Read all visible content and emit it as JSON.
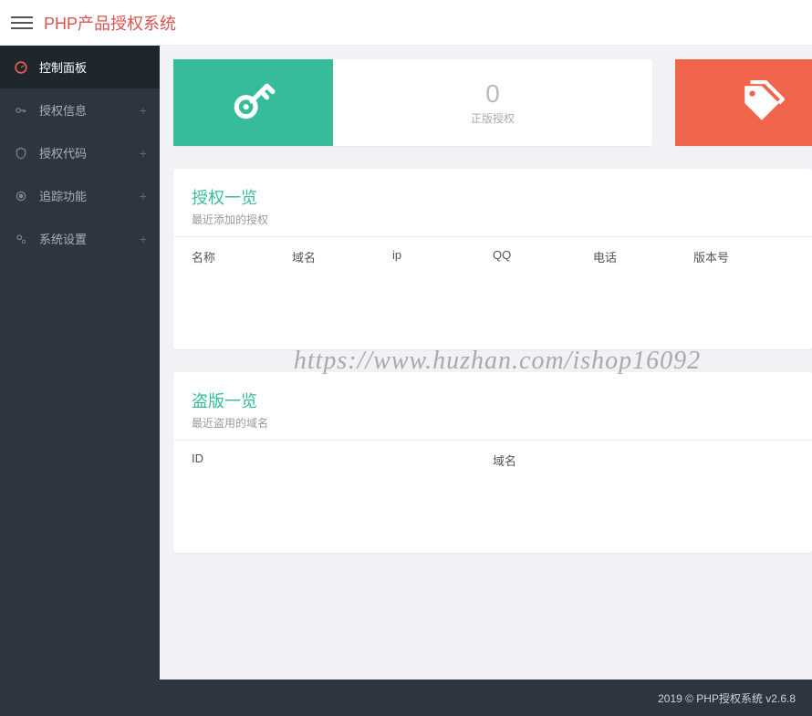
{
  "header": {
    "brand_prefix": "PHP",
    "brand_suffix": "产品授权系统"
  },
  "sidebar": {
    "items": [
      {
        "label": "控制面板",
        "icon": "dashboard",
        "expandable": false,
        "active": true
      },
      {
        "label": "授权信息",
        "icon": "key",
        "expandable": true,
        "active": false
      },
      {
        "label": "授权代码",
        "icon": "shield",
        "expandable": true,
        "active": false
      },
      {
        "label": "追踪功能",
        "icon": "target",
        "expandable": true,
        "active": false
      },
      {
        "label": "系统设置",
        "icon": "cogs",
        "expandable": true,
        "active": false
      }
    ]
  },
  "stats": {
    "card1": {
      "value": "0",
      "label": "正版授权",
      "icon": "key",
      "color": "teal"
    },
    "card2": {
      "icon": "tags",
      "color": "red"
    }
  },
  "panels": {
    "auth": {
      "title": "授权一览",
      "subtitle": "最近添加的授权",
      "columns": [
        "名称",
        "域名",
        "ip",
        "QQ",
        "电话",
        "版本号"
      ]
    },
    "pirate": {
      "title": "盗版一览",
      "subtitle": "最近盗用的域名",
      "columns": [
        "ID",
        "域名"
      ]
    }
  },
  "footer": {
    "text": "2019 © PHP授权系统 v2.6.8"
  },
  "watermark": "https://www.huzhan.com/ishop16092"
}
